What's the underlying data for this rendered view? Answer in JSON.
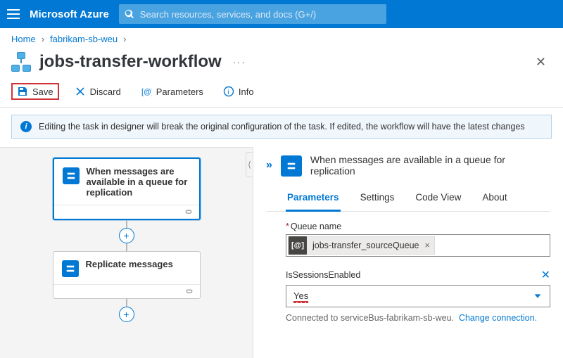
{
  "brand": "Microsoft Azure",
  "search": {
    "placeholder": "Search resources, services, and docs (G+/)"
  },
  "breadcrumb": {
    "home": "Home",
    "parent": "fabrikam-sb-weu"
  },
  "page": {
    "title": "jobs-transfer-workflow",
    "more": "···"
  },
  "toolbar": {
    "save": "Save",
    "discard": "Discard",
    "parameters": "Parameters",
    "info": "Info"
  },
  "banner": {
    "text": "Editing the task in designer will break the original configuration of the task. If edited, the workflow will have the latest changes"
  },
  "canvas": {
    "trigger": "When messages are available in a queue for replication",
    "action": "Replicate messages"
  },
  "panel": {
    "title": "When messages are available in a queue for replication",
    "tabs": {
      "parameters": "Parameters",
      "settings": "Settings",
      "codeview": "Code View",
      "about": "About"
    },
    "queue_label": "Queue name",
    "queue_token": "jobs-transfer_sourceQueue",
    "sessions_label": "IsSessionsEnabled",
    "sessions_value": "Yes",
    "connected_prefix": "Connected to serviceBus-fabrikam-sb-weu.",
    "change_conn": "Change connection."
  }
}
